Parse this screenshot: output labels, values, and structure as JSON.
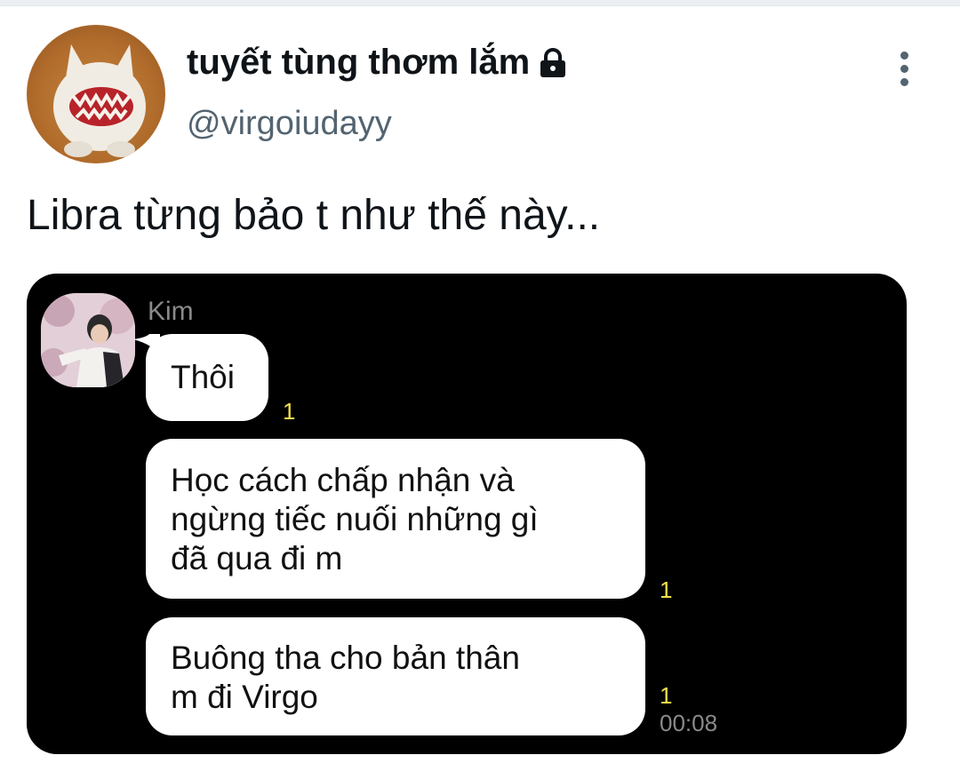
{
  "tweet": {
    "author": {
      "display_name": "tuyết tùng thơm lắm",
      "handle": "@virgoiudayy",
      "protected_icon": "lock-icon",
      "avatar": "plush-toy-avatar"
    },
    "more_icon": "more-vertical-icon",
    "text": "Libra từng bảo t như thế này..."
  },
  "chat_screenshot": {
    "sender": "Kim",
    "messages": [
      {
        "text": "Thôi",
        "read_count": "1"
      },
      {
        "lines": [
          "Học cách chấp nhận và",
          "ngừng tiếc nuối những gì",
          "đã qua đi m"
        ],
        "read_count": "1"
      },
      {
        "lines": [
          "Buông tha cho bản thân",
          "m đi Virgo"
        ],
        "read_count": "1",
        "time": "00:08"
      }
    ],
    "colors": {
      "background": "#000000",
      "bubble": "#ffffff",
      "read_count": "#f4e04d",
      "meta_text": "#8a8a8a"
    }
  },
  "colors": {
    "primary_text": "#0f1419",
    "secondary_text": "#536471"
  }
}
